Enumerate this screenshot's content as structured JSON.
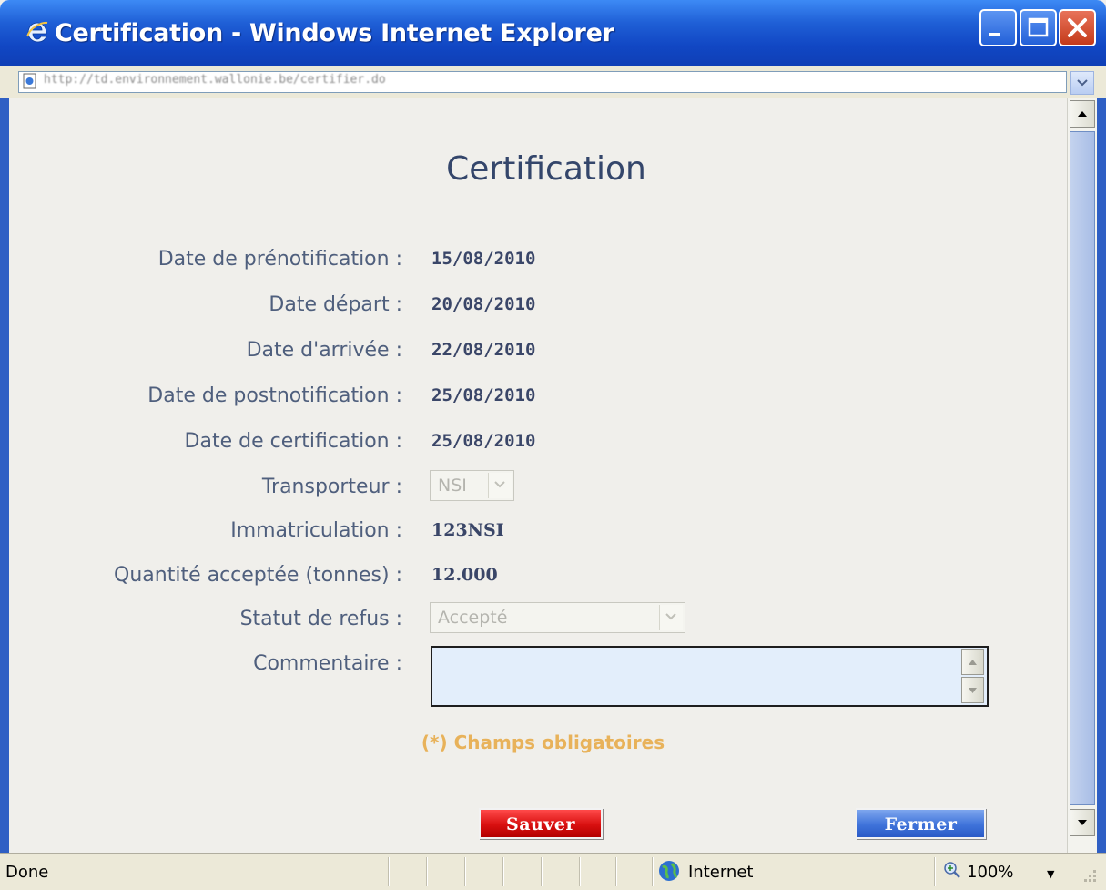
{
  "window": {
    "title": "Certification - Windows Internet Explorer",
    "address": "http://td.environnement.wallonie.be/certifier.do"
  },
  "page": {
    "title": "Certification"
  },
  "fields": [
    {
      "label": "Date de prénotification :",
      "value": "15/08/2010"
    },
    {
      "label": "Date départ :",
      "value": "20/08/2010"
    },
    {
      "label": "Date d'arrivée :",
      "value": "22/08/2010"
    },
    {
      "label": "Date de postnotification :",
      "value": "25/08/2010"
    },
    {
      "label": "Date de certification :",
      "value": "25/08/2010"
    }
  ],
  "transporteur": {
    "label": "Transporteur :",
    "value": "NSI"
  },
  "immatriculation": {
    "label": "Immatriculation :",
    "value": "123NSI"
  },
  "quantite": {
    "label": "Quantité acceptée (tonnes) :",
    "value": "12.000"
  },
  "statut": {
    "label": "Statut de refus :",
    "value": "Accepté"
  },
  "commentaire": {
    "label": "Commentaire :",
    "value": ""
  },
  "required_note": "(*) Champs obligatoires",
  "buttons": {
    "save": "Sauver",
    "close": "Fermer"
  },
  "status": {
    "text": "Done",
    "zone": "Internet",
    "zoom": "100%"
  },
  "colors": {
    "titlebar": "#1f5fd6",
    "label": "#4f5f7d",
    "value": "#3a4668",
    "required": "#e8b25a",
    "save_button": "#d81010",
    "close_button": "#3f73da",
    "textarea_bg": "#e3eefb"
  },
  "icons": {
    "title": "ie-logo-icon",
    "address": "ie-page-icon",
    "zone": "globe-icon",
    "zoom": "magnifier-icon"
  }
}
